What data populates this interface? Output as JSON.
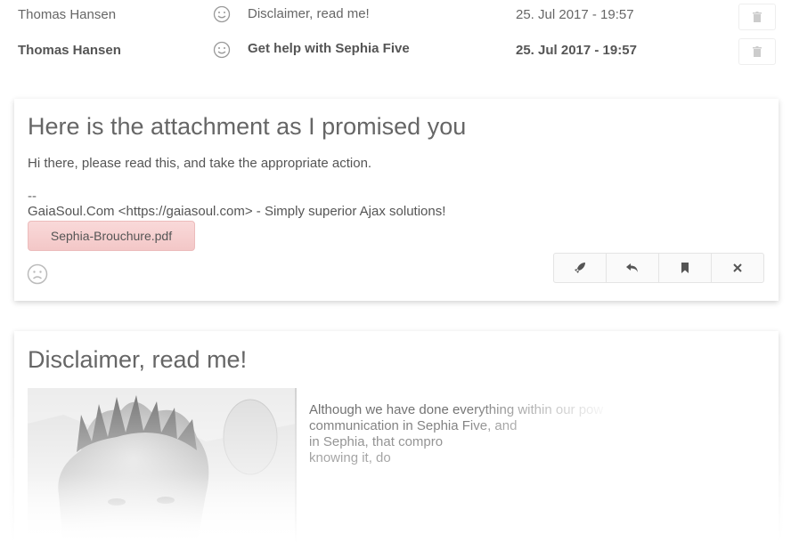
{
  "messages": [
    {
      "from": "Thomas Hansen",
      "subject": "Disclaimer, read me!",
      "date": "25. Jul 2017 - 19:57",
      "unread": false
    },
    {
      "from": "Thomas Hansen",
      "subject": "Get help with Sephia Five",
      "date": "25. Jul 2017 - 19:57",
      "unread": true
    }
  ],
  "open_message": {
    "title": "Here is the attachment as I promised you",
    "body": "Hi there, please read this, and take the appropriate action.",
    "signature_dash": "--",
    "signature": "GaiaSoul.Com <https://gaiasoul.com> - Simply superior Ajax solutions!",
    "attachment": "Sephia-Brouchure.pdf",
    "actions": [
      "rocket-icon",
      "reply-icon",
      "bookmark-icon",
      "close-icon"
    ]
  },
  "second_message": {
    "title": "Disclaimer, read me!",
    "lines": [
      "Although we have done everything within our pow",
      "communication in Sephia Five, and",
      "in Sephia, that compro",
      "knowing it, do"
    ]
  },
  "colors": {
    "attachment_bg": "#f3c7c7",
    "text": "#555555"
  }
}
